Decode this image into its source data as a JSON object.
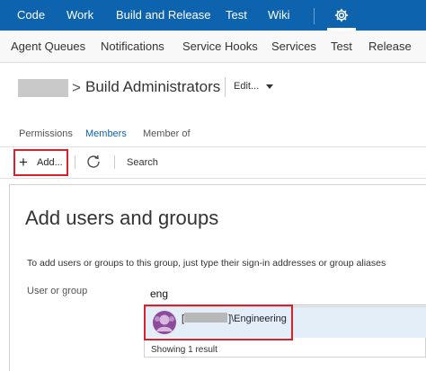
{
  "top_nav": {
    "items": [
      {
        "label": "Code"
      },
      {
        "label": "Work"
      },
      {
        "label": "Build and Release"
      },
      {
        "label": "Test"
      },
      {
        "label": "Wiki"
      }
    ],
    "settings_icon": "gear-icon",
    "background": "#0e63ae"
  },
  "sub_nav": {
    "items": [
      {
        "label": "Agent Queues"
      },
      {
        "label": "Notifications"
      },
      {
        "label": "Service Hooks"
      },
      {
        "label": "Services"
      },
      {
        "label": "Test"
      },
      {
        "label": "Release"
      }
    ]
  },
  "header": {
    "separator": ">",
    "title": "Build Administrators",
    "edit_label": "Edit..."
  },
  "tabs": [
    {
      "label": "Permissions",
      "active": false
    },
    {
      "label": "Members",
      "active": true
    },
    {
      "label": "Member of",
      "active": false
    }
  ],
  "toolbar": {
    "add_icon": "plus-icon",
    "add_label": "Add...",
    "refresh_icon": "refresh-icon",
    "search_label": "Search"
  },
  "dialog": {
    "title": "Add users and groups",
    "description": "To add users or groups to this group, just type their sign-in addresses or group aliases",
    "field_label": "User or group",
    "input_value": "eng",
    "result": {
      "avatar_icon": "group-avatar-icon",
      "name_prefix": "[",
      "name_suffix": "]\\Engineering"
    },
    "result_count": "Showing 1 result"
  },
  "colors": {
    "accent": "#0e63ae",
    "highlight_border": "#d8212c",
    "selected_row": "#e4eef9",
    "avatar": "#8e4b9c"
  }
}
